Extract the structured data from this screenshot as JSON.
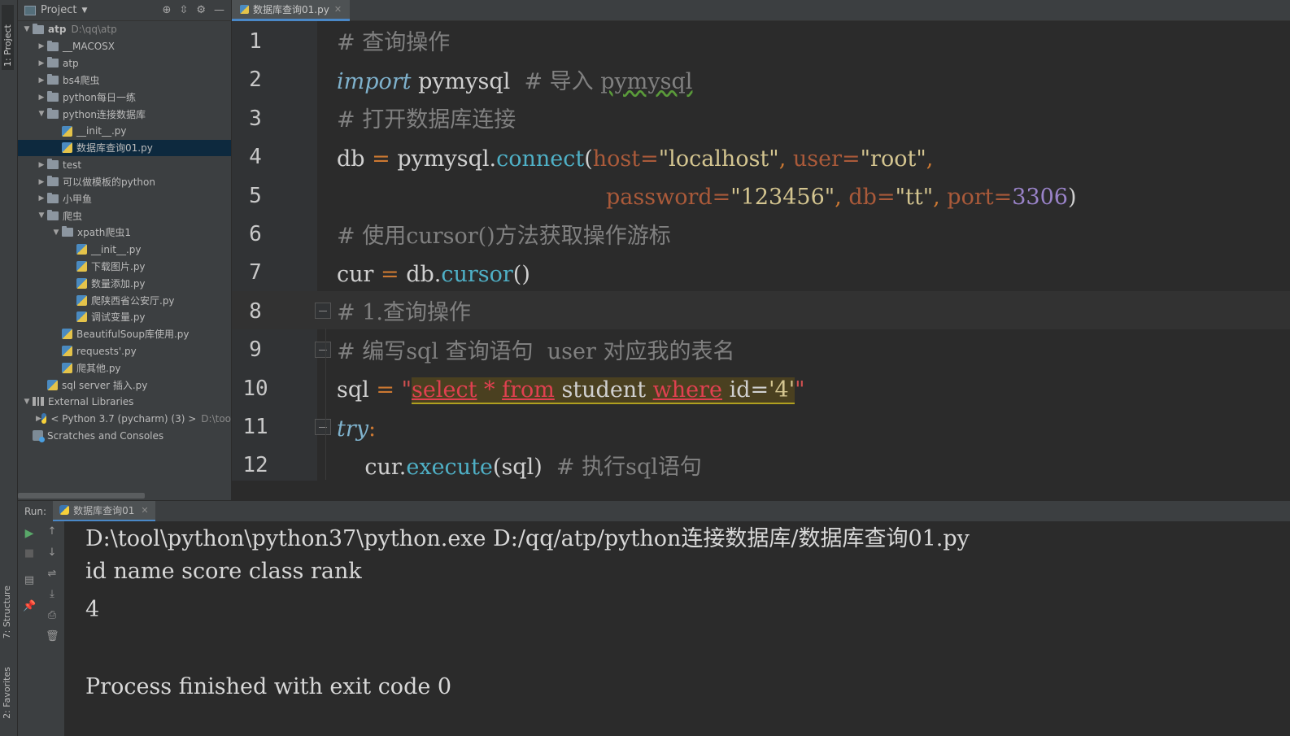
{
  "side_tabs": {
    "project": "1: Project",
    "structure": "7: Structure",
    "favorites": "2: Favorites"
  },
  "project_panel": {
    "title": "Project",
    "tree": [
      {
        "label": "atp",
        "path": "D:\\qq\\atp",
        "kind": "folder",
        "depth": 0,
        "expanded": true
      },
      {
        "label": "__MACOSX",
        "kind": "folder",
        "depth": 1,
        "expanded": false
      },
      {
        "label": "atp",
        "kind": "folder",
        "depth": 1,
        "expanded": false
      },
      {
        "label": "bs4爬虫",
        "kind": "folder",
        "depth": 1,
        "expanded": false
      },
      {
        "label": "python每日一练",
        "kind": "folder",
        "depth": 1,
        "expanded": false
      },
      {
        "label": "python连接数据库",
        "kind": "folder",
        "depth": 1,
        "expanded": true
      },
      {
        "label": "__init__.py",
        "kind": "py",
        "depth": 2
      },
      {
        "label": "数据库查询01.py",
        "kind": "py",
        "depth": 2,
        "selected": true
      },
      {
        "label": "test",
        "kind": "folder",
        "depth": 1,
        "expanded": false
      },
      {
        "label": "可以做模板的python",
        "kind": "folder",
        "depth": 1,
        "expanded": false
      },
      {
        "label": "小甲鱼",
        "kind": "folder",
        "depth": 1,
        "expanded": false
      },
      {
        "label": "爬虫",
        "kind": "folder",
        "depth": 1,
        "expanded": true
      },
      {
        "label": "xpath爬虫1",
        "kind": "folder",
        "depth": 2,
        "expanded": true
      },
      {
        "label": "__init__.py",
        "kind": "py",
        "depth": 3
      },
      {
        "label": "下载图片.py",
        "kind": "py",
        "depth": 3
      },
      {
        "label": "数量添加.py",
        "kind": "py",
        "depth": 3
      },
      {
        "label": "爬陕西省公安厅.py",
        "kind": "py",
        "depth": 3
      },
      {
        "label": "调试变量.py",
        "kind": "py",
        "depth": 3
      },
      {
        "label": "BeautifulSoup库使用.py",
        "kind": "py",
        "depth": 2
      },
      {
        "label": "requests'.py",
        "kind": "py",
        "depth": 2
      },
      {
        "label": "爬其他.py",
        "kind": "py",
        "depth": 2
      },
      {
        "label": "sql server 插入.py",
        "kind": "py",
        "depth": 1
      },
      {
        "label": "External Libraries",
        "kind": "lib",
        "depth": 0,
        "expanded": true
      },
      {
        "label": "< Python 3.7 (pycharm) (3) >",
        "path": "D:\\too",
        "kind": "python",
        "depth": 1,
        "expanded": false
      },
      {
        "label": "Scratches and Consoles",
        "kind": "scratch",
        "depth": 0
      }
    ]
  },
  "editor": {
    "tab_label": "数据库查询01.py",
    "line_numbers": [
      "1",
      "2",
      "3",
      "4",
      "5",
      "6",
      "7",
      "8",
      "9",
      "10",
      "11",
      "12"
    ],
    "highlighted_line": "8",
    "lines": {
      "l1": "# 查询操作",
      "l2_kw": "import",
      "l2_mod": " pymysql  ",
      "l2_com": "# 导入 ",
      "l2_squig": "pymysql",
      "l3": "# 打开数据库连接",
      "l4": {
        "a": "db ",
        "eq": "=",
        "b": " pymysql.",
        "fn": "connect",
        "p1": "(",
        "k1": "host=",
        "s1": "\"localhost\"",
        "c1": ", ",
        "k2": "user=",
        "s2": "\"root\"",
        "c2": ","
      },
      "l5": {
        "k1": "password=",
        "s1": "\"123456\"",
        "c1": ", ",
        "k2": "db=",
        "s2": "\"tt\"",
        "c2": ", ",
        "k3": "port=",
        "n1": "3306",
        "p2": ")"
      },
      "l6": "# 使用cursor()方法获取操作游标",
      "l7": {
        "a": "cur ",
        "eq": "=",
        "b": " db.",
        "fn": "cursor",
        "p": "()"
      },
      "l8": "# 1.查询操作",
      "l9": "# 编写sql 查询语句  user 对应我的表名",
      "l10": {
        "a": "sql ",
        "eq": "=",
        "sp": " ",
        "q1": "\"",
        "k1": "select",
        "x1": " * ",
        "k2": "from",
        "x2": " student ",
        "k3": "where",
        "x3": " id=",
        "v": "'4'",
        "q2": "\""
      },
      "l11": {
        "kw": "try",
        "colon": ":"
      },
      "l12": {
        "a": "    cur.",
        "fn": "execute",
        "b": "(sql)  ",
        "com": "# 执行sql语句"
      }
    }
  },
  "run_panel": {
    "label": "Run:",
    "tab_label": "数据库查询01",
    "output": [
      "D:\\tool\\python\\python37\\python.exe D:/qq/atp/python连接数据库/数据库查询01.py",
      "id name score class rank",
      "4",
      "",
      "Process finished with exit code 0"
    ]
  }
}
